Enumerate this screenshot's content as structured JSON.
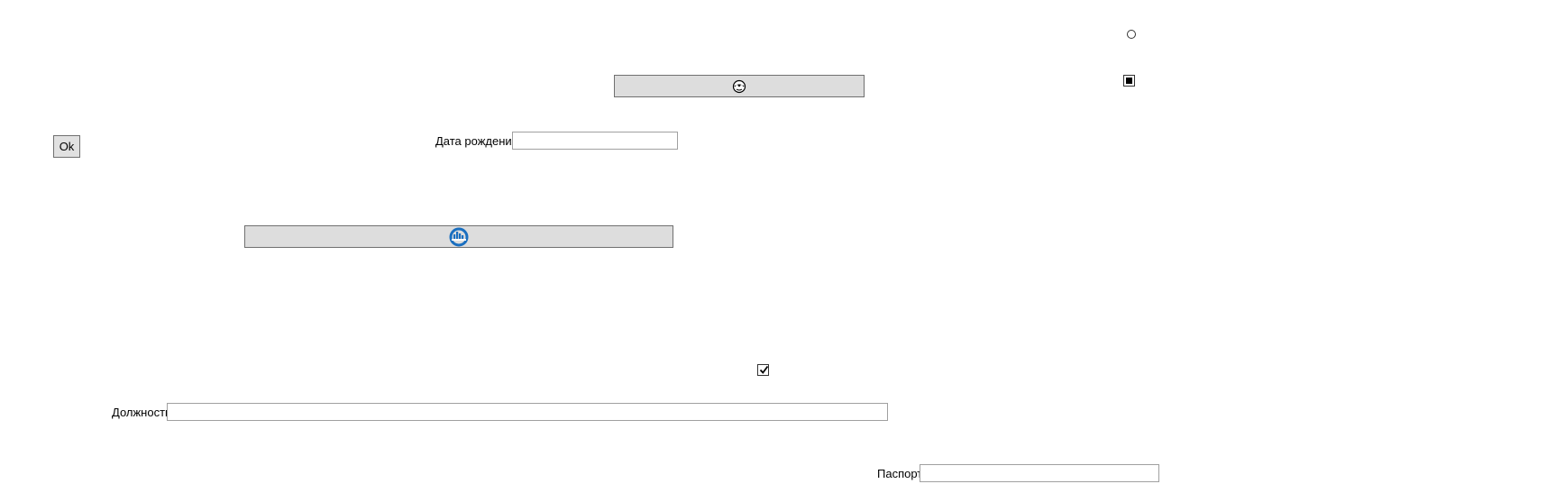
{
  "form": {
    "ok_label": "Ok",
    "birth_date_label": "Дата рождения",
    "birth_date_value": "",
    "position_label": "Должность",
    "position_value": "",
    "passport_label": "Паспорт",
    "passport_value": ""
  },
  "icons": {
    "top_button_icon": "face-mask-icon",
    "middle_button_icon": "city-skyline-icon",
    "accent": "#1a6fc0"
  },
  "controls": {
    "radio_checked": false,
    "indeterminate_checkbox": "indeterminate",
    "checkbox_checked": true
  }
}
